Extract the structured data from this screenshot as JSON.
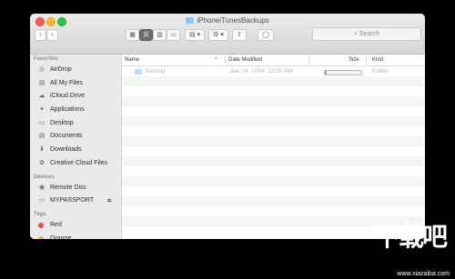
{
  "window": {
    "title": "iPhoneiTunesBackups"
  },
  "toolbar": {
    "back": "‹",
    "forward": "›",
    "view_icons": "▦",
    "view_list": "☰",
    "view_columns": "▥",
    "view_gallery": "▭",
    "arrange": "▤ ▾",
    "action": "⚙ ▾",
    "share": "⇧",
    "tag": "◯",
    "search_label": "Search"
  },
  "sidebar": {
    "favorites_header": "Favorites",
    "favorites": [
      {
        "label": "AirDrop",
        "icon": "airdrop-icon",
        "glyph": "◎"
      },
      {
        "label": "All My Files",
        "icon": "all-files-icon",
        "glyph": "▤"
      },
      {
        "label": "iCloud Drive",
        "icon": "cloud-icon",
        "glyph": "☁"
      },
      {
        "label": "Applications",
        "icon": "applications-icon",
        "glyph": "✦"
      },
      {
        "label": "Desktop",
        "icon": "desktop-icon",
        "glyph": "▭"
      },
      {
        "label": "Documents",
        "icon": "documents-icon",
        "glyph": "▤"
      },
      {
        "label": "Downloads",
        "icon": "downloads-icon",
        "glyph": "⬇"
      },
      {
        "label": "Creative Cloud Files",
        "icon": "creative-cloud-icon",
        "glyph": "✿"
      }
    ],
    "devices_header": "Devices",
    "devices": [
      {
        "label": "Remote Disc",
        "icon": "disc-icon",
        "glyph": "◉"
      },
      {
        "label": "MYPASSPORT",
        "icon": "drive-icon",
        "glyph": "▭",
        "eject": "⏏"
      }
    ],
    "tags_header": "Tags",
    "tags": [
      {
        "label": "Red",
        "color": "#ef4b4b"
      },
      {
        "label": "Orange",
        "color": "#f6a23b"
      }
    ]
  },
  "columns": {
    "name": "Name",
    "sort_indicator": "^",
    "date": "Date Modified",
    "size": "Size",
    "kind": "Kind"
  },
  "rows": [
    {
      "name": "Backup",
      "date": "Jan 24, 1984, 12:00 AM",
      "size_progress": 0.05,
      "kind": "Folder"
    }
  ],
  "watermark": {
    "logo_text": "下载吧",
    "url": "www.xiazaiba.com"
  }
}
